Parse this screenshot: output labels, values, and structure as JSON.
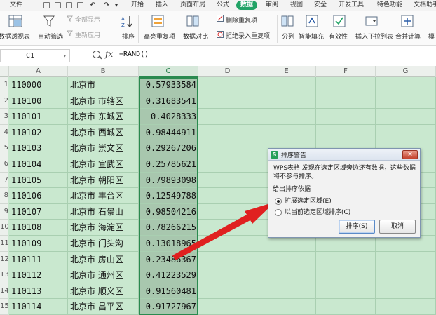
{
  "menubar": {
    "file": "文件",
    "tabs": [
      "开始",
      "插入",
      "页面布局",
      "公式",
      "数据",
      "审阅",
      "视图",
      "安全",
      "开发工具",
      "特色功能",
      "文档助手"
    ],
    "active_tab": "数据"
  },
  "ribbon": {
    "pivot": "数据透视表",
    "autofilter": "自动筛选",
    "show_all": "全部显示",
    "reapply": "重新应用",
    "sort": "排序",
    "highlight_dup": "高亮重复项",
    "data_compare": "数据对比",
    "remove_dup": "删除重复项",
    "reject_dup": "拒绝录入重复项",
    "split": "分列",
    "smart_fill": "智能填充",
    "validity": "有效性",
    "insert_dropdown": "插入下拉列表",
    "consolidate": "合并计算",
    "more": "模"
  },
  "formula_bar": {
    "name_box": "C1",
    "fx": "fx",
    "formula": "=RAND()"
  },
  "grid": {
    "columns": [
      "A",
      "B",
      "C",
      "D",
      "E",
      "F",
      "G"
    ],
    "row_numbers": [
      "1",
      "2",
      "3",
      "4",
      "5",
      "6",
      "7",
      "8",
      "9",
      "10",
      "11",
      "12",
      "13",
      "14",
      "15"
    ],
    "rows": [
      [
        "110000",
        "北京市",
        "0.57933584"
      ],
      [
        "110100",
        "北京市  市辖区",
        "0.31683541"
      ],
      [
        "110101",
        "北京市  东城区",
        "0.4028333"
      ],
      [
        "110102",
        "北京市  西城区",
        "0.98444911"
      ],
      [
        "110103",
        "北京市  崇文区",
        "0.29267206"
      ],
      [
        "110104",
        "北京市  宣武区",
        "0.25785621"
      ],
      [
        "110105",
        "北京市  朝阳区",
        "0.79893098"
      ],
      [
        "110106",
        "北京市  丰台区",
        "0.12549788"
      ],
      [
        "110107",
        "北京市  石景山",
        "0.98504216"
      ],
      [
        "110108",
        "北京市  海淀区",
        "0.78266215"
      ],
      [
        "110109",
        "北京市  门头沟",
        "0.13018965"
      ],
      [
        "110111",
        "北京市  房山区",
        "0.23486367"
      ],
      [
        "110112",
        "北京市  通州区",
        "0.41223529"
      ],
      [
        "110113",
        "北京市  顺义区",
        "0.91560481"
      ],
      [
        "110114",
        "北京市  昌平区",
        "0.91727967"
      ]
    ]
  },
  "dialog": {
    "title": "排序警告",
    "message": "WPS表格 发现在选定区域旁边还有数据，这些数据将不参与排序。",
    "group_label": "给出排序依据",
    "option_expand": "扩展选定区域(E)",
    "option_current": "以当前选定区域排序(C)",
    "selected_option": "expand",
    "sort_button": "排序(S)",
    "cancel_button": "取消",
    "close_symbol": "×"
  },
  "colors": {
    "accent_green": "#21a366",
    "sheet_bg": "#c9e8cf",
    "selected_cells": "#a8c7ae",
    "arrow_red": "#e02020"
  }
}
